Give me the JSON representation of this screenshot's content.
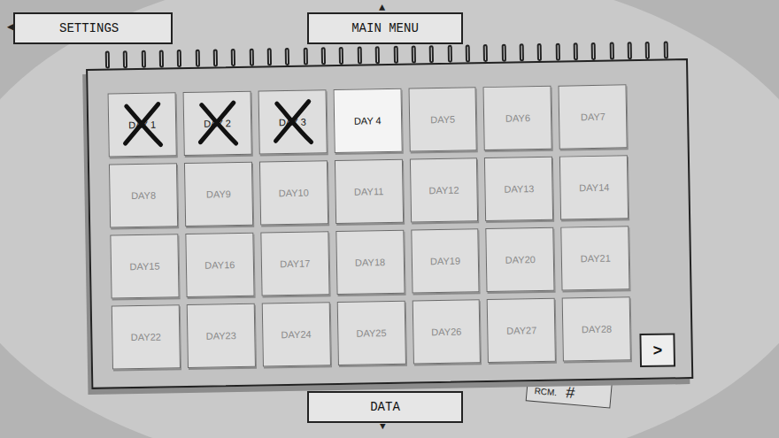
{
  "nav": {
    "settings": {
      "label": "SETTINGS",
      "arrow": "◀"
    },
    "main_menu": {
      "label": "MAIN MENU",
      "arrow": "▲"
    },
    "data": {
      "label": "DATA",
      "arrow": "▼"
    }
  },
  "calendar": {
    "days": [
      {
        "label": "DAY 1",
        "crossed": true,
        "selected": false,
        "disabled": false
      },
      {
        "label": "DAY 2",
        "crossed": true,
        "selected": false,
        "disabled": false
      },
      {
        "label": "DAY 3",
        "crossed": true,
        "selected": false,
        "disabled": false
      },
      {
        "label": "DAY 4",
        "crossed": false,
        "selected": true,
        "disabled": false
      },
      {
        "label": "DAY5",
        "crossed": false,
        "selected": false,
        "disabled": true
      },
      {
        "label": "DAY6",
        "crossed": false,
        "selected": false,
        "disabled": true
      },
      {
        "label": "DAY7",
        "crossed": false,
        "selected": false,
        "disabled": true
      },
      {
        "label": "DAY8",
        "crossed": false,
        "selected": false,
        "disabled": true
      },
      {
        "label": "DAY9",
        "crossed": false,
        "selected": false,
        "disabled": true
      },
      {
        "label": "DAY10",
        "crossed": false,
        "selected": false,
        "disabled": true
      },
      {
        "label": "DAY11",
        "crossed": false,
        "selected": false,
        "disabled": true
      },
      {
        "label": "DAY12",
        "crossed": false,
        "selected": false,
        "disabled": true
      },
      {
        "label": "DAY13",
        "crossed": false,
        "selected": false,
        "disabled": true
      },
      {
        "label": "DAY14",
        "crossed": false,
        "selected": false,
        "disabled": true
      },
      {
        "label": "DAY15",
        "crossed": false,
        "selected": false,
        "disabled": true
      },
      {
        "label": "DAY16",
        "crossed": false,
        "selected": false,
        "disabled": true
      },
      {
        "label": "DAY17",
        "crossed": false,
        "selected": false,
        "disabled": true
      },
      {
        "label": "DAY18",
        "crossed": false,
        "selected": false,
        "disabled": true
      },
      {
        "label": "DAY19",
        "crossed": false,
        "selected": false,
        "disabled": true
      },
      {
        "label": "DAY20",
        "crossed": false,
        "selected": false,
        "disabled": true
      },
      {
        "label": "DAY21",
        "crossed": false,
        "selected": false,
        "disabled": true
      },
      {
        "label": "DAY22",
        "crossed": false,
        "selected": false,
        "disabled": true
      },
      {
        "label": "DAY23",
        "crossed": false,
        "selected": false,
        "disabled": true
      },
      {
        "label": "DAY24",
        "crossed": false,
        "selected": false,
        "disabled": true
      },
      {
        "label": "DAY25",
        "crossed": false,
        "selected": false,
        "disabled": true
      },
      {
        "label": "DAY26",
        "crossed": false,
        "selected": false,
        "disabled": true
      },
      {
        "label": "DAY27",
        "crossed": false,
        "selected": false,
        "disabled": true
      },
      {
        "label": "DAY28",
        "crossed": false,
        "selected": false,
        "disabled": true
      }
    ],
    "next_button": ">"
  },
  "note": {
    "text": "RCM.",
    "mark": "#"
  }
}
